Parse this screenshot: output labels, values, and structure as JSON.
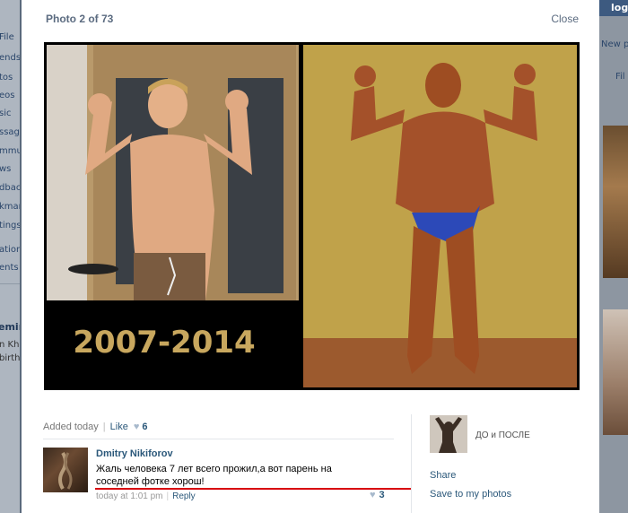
{
  "background": {
    "left_items": [
      "File",
      "ends",
      "tos",
      "eos",
      "sic",
      "ssage",
      "mmu",
      "ws",
      "dbac",
      "kmar",
      "tings",
      "ations",
      "ents"
    ],
    "left_user_name": "emir",
    "left_user_sub": [
      "n Kha",
      "birtho"
    ],
    "right_login": "log",
    "right_new_post": "New po",
    "right_filter": "Fil"
  },
  "viewer": {
    "counter": "Photo 2 of 73",
    "close_label": "Close",
    "photo_caption": "2007-2014"
  },
  "meta": {
    "added": "Added today",
    "like_label": "Like",
    "like_count": "6"
  },
  "comment": {
    "author": "Dmitry Nikiforov",
    "text": "Жаль человека 7 лет всего прожил,а вот парень на соседней фотке хорош!",
    "time": "today at 1:01 pm",
    "reply_label": "Reply",
    "likes": "3"
  },
  "sidebar": {
    "album_name": "ДО и ПОСЛЕ",
    "share_label": "Share",
    "save_label": "Save to my photos"
  },
  "colors": {
    "link": "#2b587a",
    "highlight_underline": "#d8000c",
    "caption_gold": "#c8a75e"
  }
}
